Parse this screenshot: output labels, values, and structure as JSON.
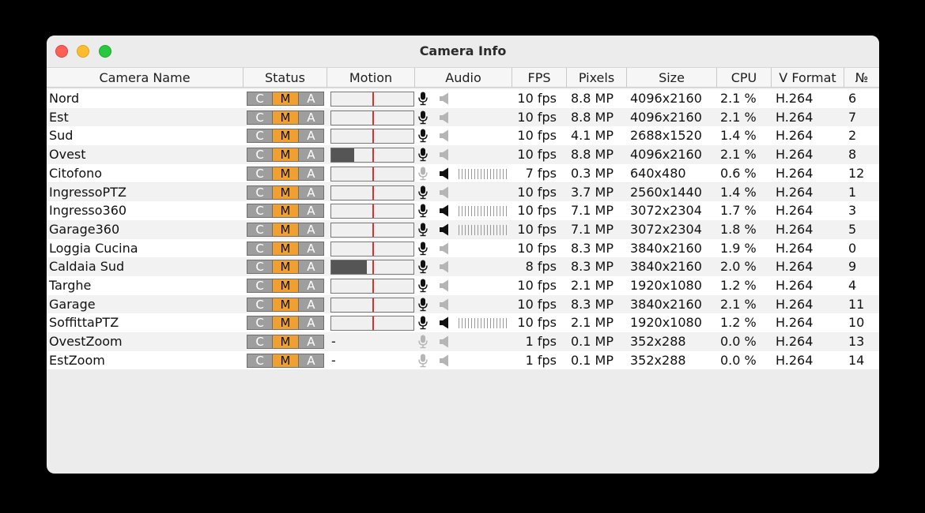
{
  "window": {
    "title": "Camera Info"
  },
  "columns": [
    "Camera Name",
    "Status",
    "Motion",
    "Audio",
    "FPS",
    "Pixels",
    "Size",
    "CPU",
    "V Format",
    "№"
  ],
  "status_buttons": {
    "c": "C",
    "m": "M",
    "a": "A"
  },
  "rows": [
    {
      "name": "Nord",
      "fps": "10 fps",
      "pixels": "8.8 MP",
      "size": "4096x2160",
      "cpu": "2.1 %",
      "vformat": "H.264",
      "no": "6",
      "motion_level": 0,
      "motion_active": true,
      "mic": true,
      "speaker": false,
      "level": false
    },
    {
      "name": "Est",
      "fps": "10 fps",
      "pixels": "8.8 MP",
      "size": "4096x2160",
      "cpu": "2.1 %",
      "vformat": "H.264",
      "no": "7",
      "motion_level": 0,
      "motion_active": true,
      "mic": true,
      "speaker": false,
      "level": false
    },
    {
      "name": "Sud",
      "fps": "10 fps",
      "pixels": "4.1 MP",
      "size": "2688x1520",
      "cpu": "1.4 %",
      "vformat": "H.264",
      "no": "2",
      "motion_level": 0,
      "motion_active": true,
      "mic": true,
      "speaker": false,
      "level": false
    },
    {
      "name": "Ovest",
      "fps": "10 fps",
      "pixels": "8.8 MP",
      "size": "4096x2160",
      "cpu": "2.1 %",
      "vformat": "H.264",
      "no": "8",
      "motion_level": 0.28,
      "motion_active": true,
      "mic": true,
      "speaker": false,
      "level": false
    },
    {
      "name": "Citofono",
      "fps": "7 fps",
      "pixels": "0.3 MP",
      "size": "640x480",
      "cpu": "0.6 %",
      "vformat": "H.264",
      "no": "12",
      "motion_level": 0,
      "motion_active": true,
      "mic": false,
      "speaker": true,
      "level": true
    },
    {
      "name": "IngressoPTZ",
      "fps": "10 fps",
      "pixels": "3.7 MP",
      "size": "2560x1440",
      "cpu": "1.4 %",
      "vformat": "H.264",
      "no": "1",
      "motion_level": 0,
      "motion_active": true,
      "mic": true,
      "speaker": false,
      "level": false
    },
    {
      "name": "Ingresso360",
      "fps": "10 fps",
      "pixels": "7.1 MP",
      "size": "3072x2304",
      "cpu": "1.7 %",
      "vformat": "H.264",
      "no": "3",
      "motion_level": 0,
      "motion_active": true,
      "mic": true,
      "speaker": true,
      "level": true
    },
    {
      "name": "Garage360",
      "fps": "10 fps",
      "pixels": "7.1 MP",
      "size": "3072x2304",
      "cpu": "1.8 %",
      "vformat": "H.264",
      "no": "5",
      "motion_level": 0,
      "motion_active": true,
      "mic": true,
      "speaker": true,
      "level": true
    },
    {
      "name": "Loggia Cucina",
      "fps": "10 fps",
      "pixels": "8.3 MP",
      "size": "3840x2160",
      "cpu": "1.9 %",
      "vformat": "H.264",
      "no": "0",
      "motion_level": 0,
      "motion_active": true,
      "mic": true,
      "speaker": false,
      "level": false
    },
    {
      "name": "Caldaia Sud",
      "fps": "8 fps",
      "pixels": "8.3 MP",
      "size": "3840x2160",
      "cpu": "2.0 %",
      "vformat": "H.264",
      "no": "9",
      "motion_level": 0.43,
      "motion_active": true,
      "mic": true,
      "speaker": false,
      "level": false
    },
    {
      "name": "Targhe",
      "fps": "10 fps",
      "pixels": "2.1 MP",
      "size": "1920x1080",
      "cpu": "1.2 %",
      "vformat": "H.264",
      "no": "4",
      "motion_level": 0,
      "motion_active": true,
      "mic": true,
      "speaker": false,
      "level": false
    },
    {
      "name": "Garage",
      "fps": "10 fps",
      "pixels": "8.3 MP",
      "size": "3840x2160",
      "cpu": "2.1 %",
      "vformat": "H.264",
      "no": "11",
      "motion_level": 0,
      "motion_active": true,
      "mic": true,
      "speaker": false,
      "level": false
    },
    {
      "name": "SoffittaPTZ",
      "fps": "10 fps",
      "pixels": "2.1 MP",
      "size": "1920x1080",
      "cpu": "1.2 %",
      "vformat": "H.264",
      "no": "10",
      "motion_level": 0,
      "motion_active": true,
      "mic": true,
      "speaker": true,
      "level": true
    },
    {
      "name": "OvestZoom",
      "fps": "1 fps",
      "pixels": "0.1 MP",
      "size": "352x288",
      "cpu": "0.0 %",
      "vformat": "H.264",
      "no": "13",
      "motion_level": 0,
      "motion_active": false,
      "motion_text": "-",
      "mic": false,
      "speaker": false,
      "level": false
    },
    {
      "name": "EstZoom",
      "fps": "1 fps",
      "pixels": "0.1 MP",
      "size": "352x288",
      "cpu": "0.0 %",
      "vformat": "H.264",
      "no": "14",
      "motion_level": 0,
      "motion_active": false,
      "motion_text": "-",
      "mic": false,
      "speaker": false,
      "level": false
    }
  ]
}
